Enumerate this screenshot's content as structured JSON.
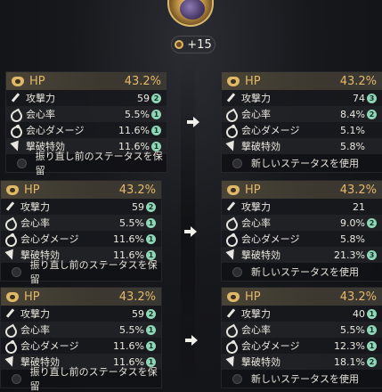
{
  "header": {
    "bonus": "+15"
  },
  "rows": [
    {
      "left": {
        "hp_label": "HP",
        "hp_value": "43.2%",
        "stats": [
          {
            "name": "攻撃力",
            "value": "59",
            "badge": "2"
          },
          {
            "name": "会心率",
            "value": "5.5%",
            "badge": "1"
          },
          {
            "name": "会心ダメージ",
            "value": "11.6%",
            "badge": "1"
          },
          {
            "name": "撃破特効",
            "value": "11.6%",
            "badge": "1"
          }
        ],
        "option": "振り直し前のステータスを保留"
      },
      "right": {
        "hp_label": "HP",
        "hp_value": "43.2%",
        "stats": [
          {
            "name": "攻撃力",
            "value": "74",
            "badge": "3"
          },
          {
            "name": "会心率",
            "value": "8.4%",
            "badge": "2"
          },
          {
            "name": "会心ダメージ",
            "value": "5.1%",
            "badge": ""
          },
          {
            "name": "撃破特効",
            "value": "5.8%",
            "badge": ""
          }
        ],
        "option": "新しいステータスを使用"
      }
    },
    {
      "left": {
        "hp_label": "HP",
        "hp_value": "43.2%",
        "stats": [
          {
            "name": "攻撃力",
            "value": "59",
            "badge": "2"
          },
          {
            "name": "会心率",
            "value": "5.5%",
            "badge": "1"
          },
          {
            "name": "会心ダメージ",
            "value": "11.6%",
            "badge": "1"
          },
          {
            "name": "撃破特効",
            "value": "11.6%",
            "badge": "1"
          }
        ],
        "option": "振り直し前のステータスを保留"
      },
      "right": {
        "hp_label": "HP",
        "hp_value": "43.2%",
        "stats": [
          {
            "name": "攻撃力",
            "value": "21",
            "badge": ""
          },
          {
            "name": "会心率",
            "value": "9.0%",
            "badge": "2"
          },
          {
            "name": "会心ダメージ",
            "value": "5.8%",
            "badge": ""
          },
          {
            "name": "撃破特効",
            "value": "21.3%",
            "badge": "3"
          }
        ],
        "option": "新しいステータスを使用"
      }
    },
    {
      "left": {
        "hp_label": "HP",
        "hp_value": "43.2%",
        "stats": [
          {
            "name": "攻撃力",
            "value": "59",
            "badge": "2"
          },
          {
            "name": "会心率",
            "value": "5.5%",
            "badge": "1"
          },
          {
            "name": "会心ダメージ",
            "value": "11.6%",
            "badge": "1"
          },
          {
            "name": "撃破特効",
            "value": "11.6%",
            "badge": "1"
          }
        ],
        "option": "振り直し前のステータスを保留"
      },
      "right": {
        "hp_label": "HP",
        "hp_value": "43.2%",
        "stats": [
          {
            "name": "攻撃力",
            "value": "40",
            "badge": "1"
          },
          {
            "name": "会心率",
            "value": "5.5%",
            "badge": "1"
          },
          {
            "name": "会心ダメージ",
            "value": "12.3%",
            "badge": "1"
          },
          {
            "name": "撃破特効",
            "value": "18.1%",
            "badge": "2"
          }
        ],
        "option": "新しいステータスを使用"
      }
    }
  ]
}
